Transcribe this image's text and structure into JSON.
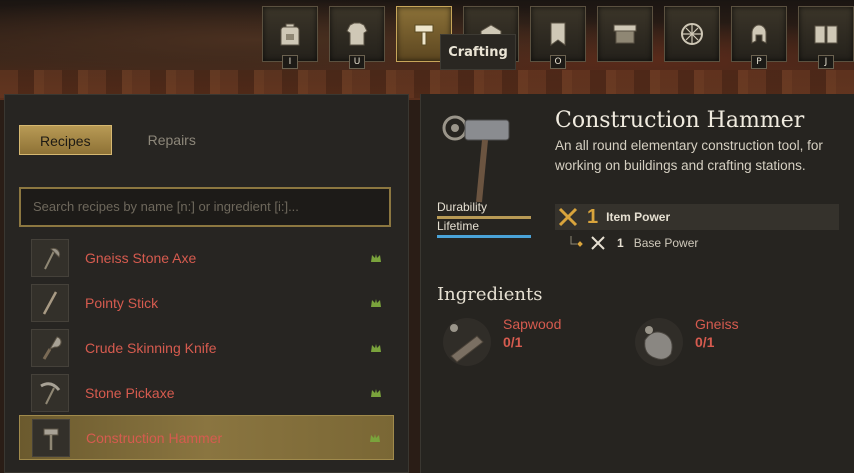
{
  "nav": {
    "buttons": [
      {
        "key": "I",
        "icon": "backpack-icon"
      },
      {
        "key": "U",
        "icon": "armor-icon"
      },
      {
        "key": "",
        "icon": "hammer-icon",
        "active": true
      },
      {
        "key": "",
        "icon": "building-icon"
      },
      {
        "key": "O",
        "icon": "banner-icon"
      },
      {
        "key": "",
        "icon": "market-stall-icon"
      },
      {
        "key": "",
        "icon": "compass-icon"
      },
      {
        "key": "P",
        "icon": "helmet-icon"
      },
      {
        "key": "J",
        "icon": "journal-icon"
      }
    ],
    "tooltip": "Crafting"
  },
  "left": {
    "tabs": {
      "recipes": "Recipes",
      "repairs": "Repairs"
    },
    "search_placeholder": "Search recipes by name [n:] or ingredient [i:]...",
    "recipes": [
      {
        "name": "Gneiss Stone Axe",
        "icon": "axe-icon"
      },
      {
        "name": "Pointy Stick",
        "icon": "stick-icon"
      },
      {
        "name": "Crude Skinning Knife",
        "icon": "knife-icon"
      },
      {
        "name": "Stone Pickaxe",
        "icon": "pickaxe-icon"
      },
      {
        "name": "Construction Hammer",
        "icon": "hammer-icon",
        "selected": true
      }
    ]
  },
  "detail": {
    "title": "Construction Hammer",
    "description": "An all round elementary construction tool, for working on buildings and crafting stations.",
    "durability_label": "Durability",
    "lifetime_label": "Lifetime",
    "item_power_value": "1",
    "item_power_label": "Item Power",
    "base_power_value": "1",
    "base_power_label": "Base Power",
    "ingredients_title": "Ingredients",
    "ingredients": [
      {
        "name": "Sapwood",
        "count": "0/1",
        "icon": "wood-log-icon"
      },
      {
        "name": "Gneiss",
        "count": "0/1",
        "icon": "stone-icon"
      }
    ]
  },
  "colors": {
    "accent_gold": "#c7a65a",
    "missing_red": "#d65b4f",
    "durability_bar": "#b89a55",
    "lifetime_bar": "#4aa3d8"
  }
}
